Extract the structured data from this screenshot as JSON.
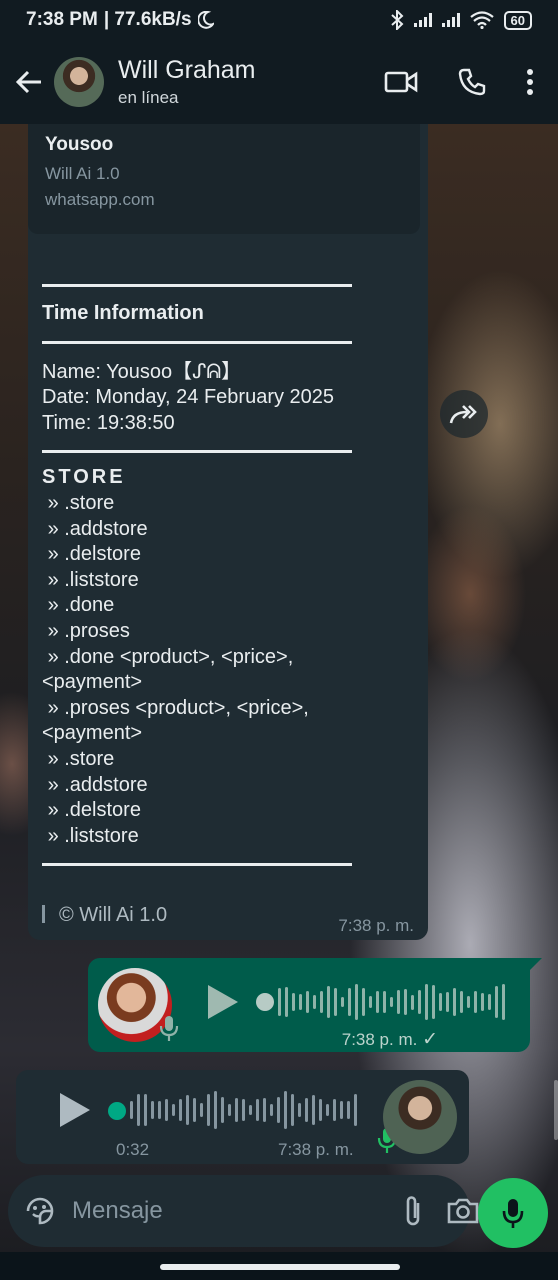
{
  "status_bar": {
    "time": "7:38 PM",
    "speed": "| 77.6kB/s",
    "battery": "60"
  },
  "header": {
    "contact_name": "Will Graham",
    "contact_status": "en línea"
  },
  "link_preview": {
    "title": "Yousoo",
    "description": "Will Ai 1.0",
    "url": "whatsapp.com"
  },
  "message": {
    "section_title": "Time Information",
    "name_line": "Name: Yousoo【ᔑᕱ】",
    "date_line": "Date: Monday, 24 February 2025",
    "time_line": "Time: 19:38:50",
    "store_title": "STORE",
    "store_commands": [
      " » .store",
      " » .addstore",
      " » .delstore",
      " » .liststore",
      " » .done",
      " » .proses",
      " » .done <product>, <price>,\n<payment>",
      " » .proses <product>, <price>,\n<payment>",
      " » .store",
      " » .addstore",
      " » .delstore",
      " » .liststore"
    ],
    "footer": "© Will Ai 1.0",
    "time": "7:38 p. m."
  },
  "voice_out": {
    "time": "7:38 p. m.",
    "check": "✓"
  },
  "voice_in": {
    "duration": "0:32",
    "time": "7:38 p. m."
  },
  "input": {
    "placeholder": "Mensaje"
  },
  "colors": {
    "header_bg": "#111b21",
    "incoming_bubble": "#1f2c33",
    "outgoing_bubble": "#005c4b",
    "accent_green": "#21c063",
    "progress_dot": "#00a884"
  }
}
